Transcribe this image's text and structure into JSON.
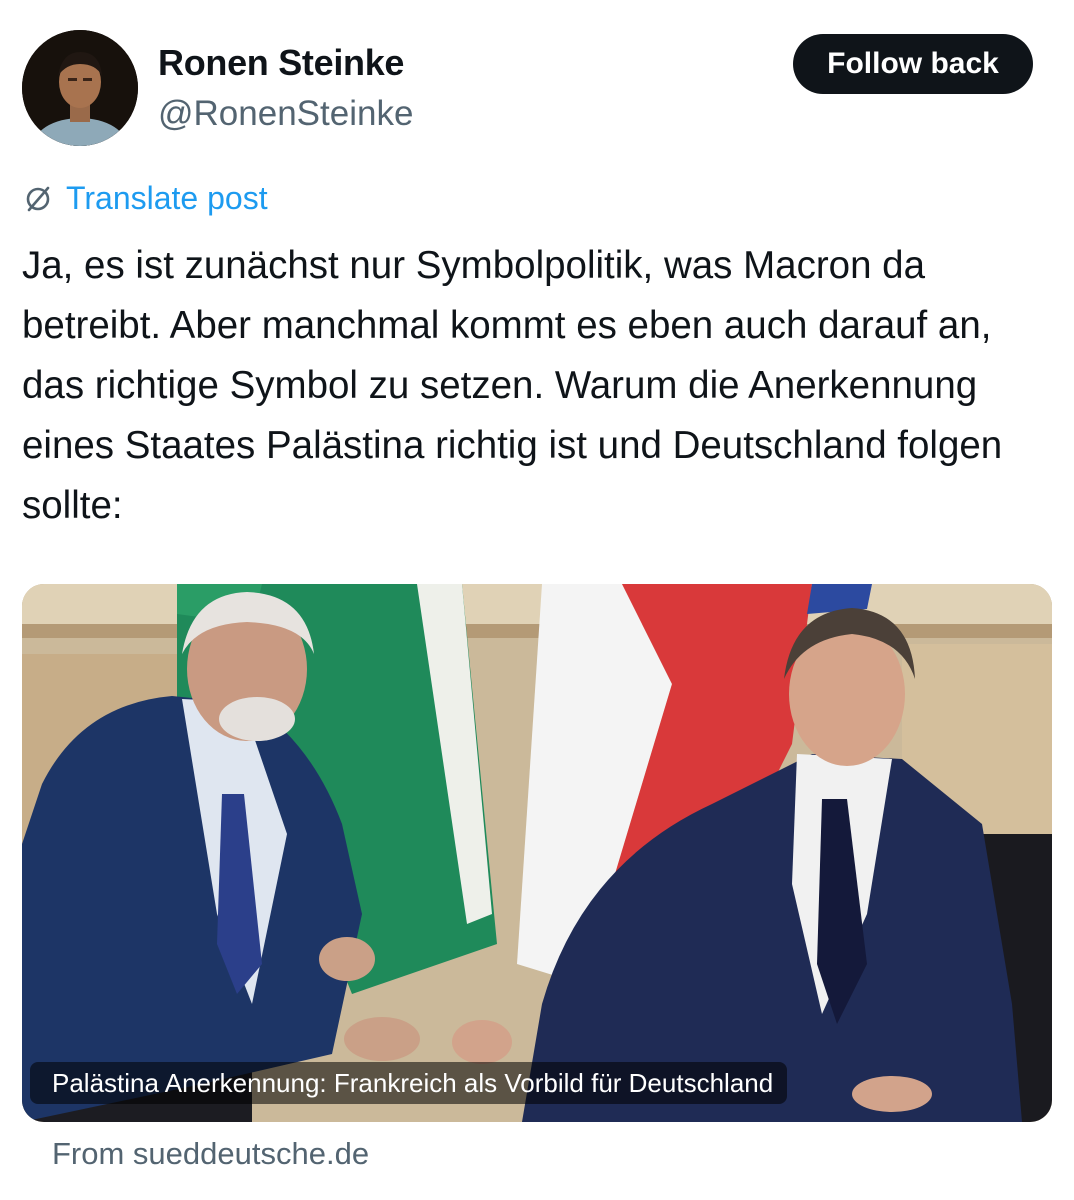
{
  "author": {
    "display_name": "Ronen Steinke",
    "handle": "@RonenSteinke"
  },
  "follow_button_label": "Follow back",
  "translate": {
    "icon": "translate-globe-icon",
    "label": "Translate post"
  },
  "post": {
    "text": "Ja, es ist zunächst nur Symbolpolitik, was Macron da betreibt. Aber manchmal kommt es eben auch darauf an, das richtige Symbol zu setzen. Warum die Anerkennung eines Staates Palästina richtig ist und Deutschland folgen sollte:"
  },
  "link_card": {
    "caption": "Palästina Anerkennung: Frankreich als Vorbild für Deutschland",
    "source": "From sueddeutsche.de"
  },
  "colors": {
    "accent": "#1d9bf0",
    "text": "#0f1419",
    "secondary": "#536471",
    "button_bg": "#0f1419"
  }
}
